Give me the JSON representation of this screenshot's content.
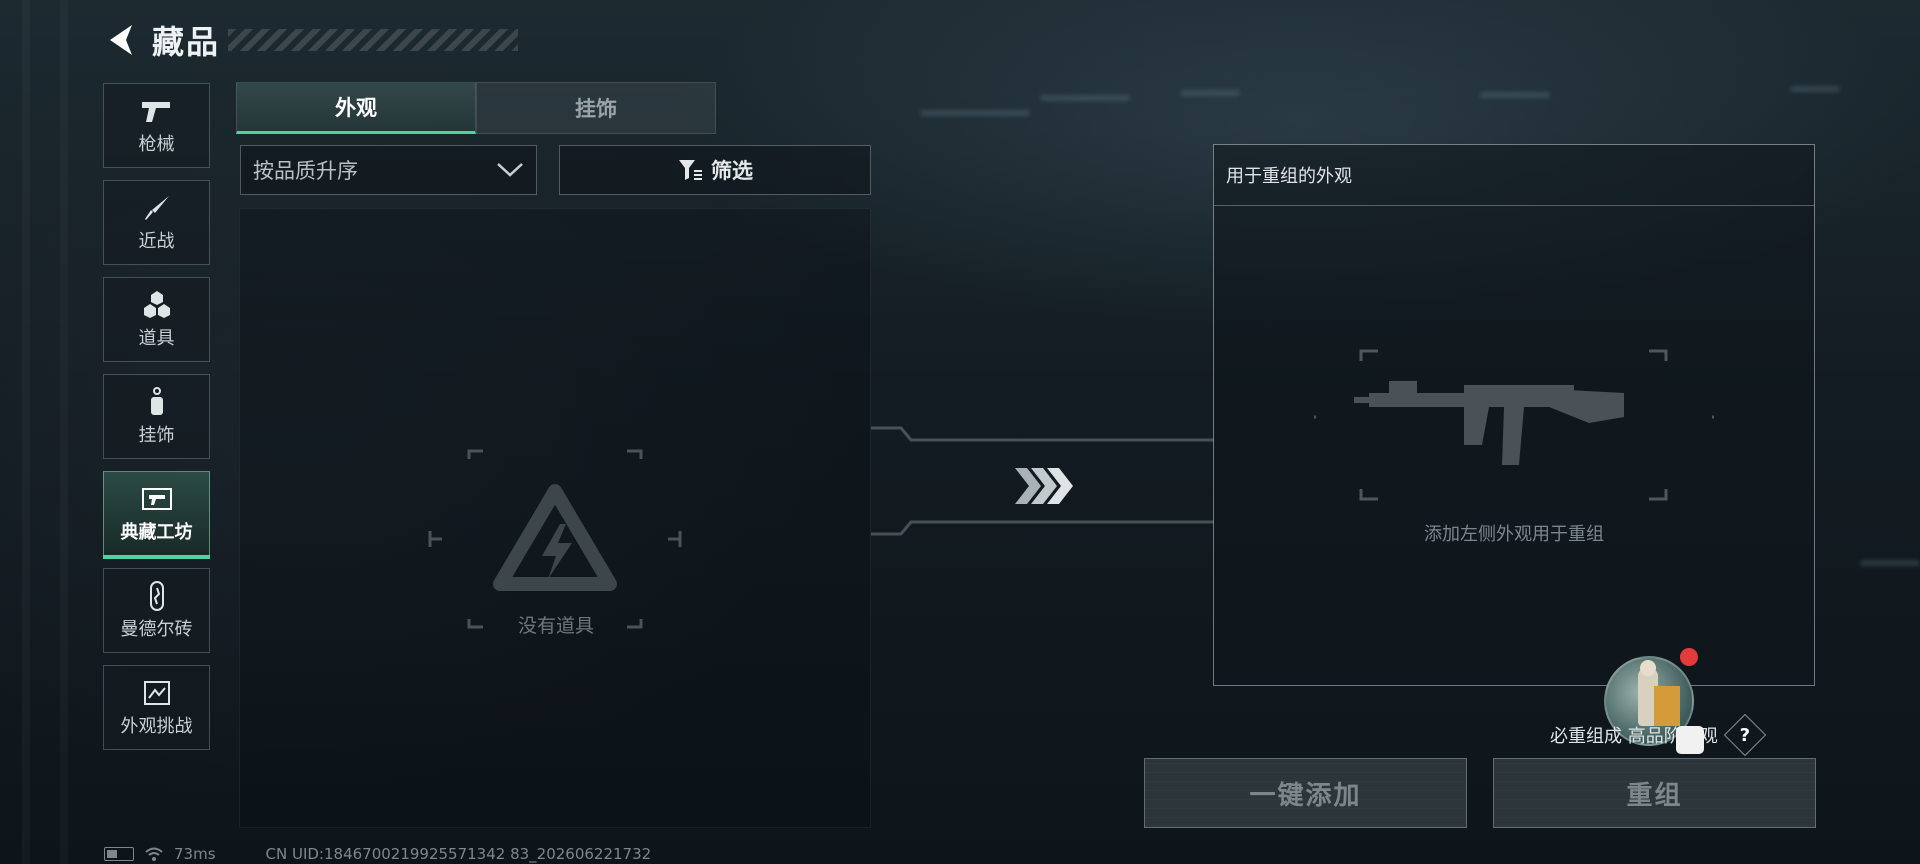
{
  "header": {
    "title": "藏品"
  },
  "sidebar": {
    "items": [
      {
        "label": "枪械",
        "icon": "pistol-icon",
        "active": false
      },
      {
        "label": "近战",
        "icon": "knife-icon",
        "active": false
      },
      {
        "label": "道具",
        "icon": "grenade-cluster-icon",
        "active": false
      },
      {
        "label": "挂饰",
        "icon": "charm-icon",
        "active": false
      },
      {
        "label": "典藏工坊",
        "icon": "workshop-icon",
        "active": true
      },
      {
        "label": "曼德尔砖",
        "icon": "brick-icon",
        "active": false
      },
      {
        "label": "外观挑战",
        "icon": "challenge-icon",
        "active": false
      }
    ]
  },
  "tabs": [
    {
      "label": "外观",
      "active": true
    },
    {
      "label": "挂饰",
      "active": false
    }
  ],
  "sort": {
    "value": "按品质升序"
  },
  "filter": {
    "label": "筛选"
  },
  "list": {
    "empty_text": "没有道具"
  },
  "recombine": {
    "title": "用于重组的外观",
    "hint": "添加左侧外观用于重组"
  },
  "chance": {
    "text": "必重组成  高品阶外观"
  },
  "buttons": {
    "add_all": "一键添加",
    "recombine": "重组"
  },
  "status": {
    "latency": "73ms",
    "uid": "CN UID:1846700219925571342 83_202606221732"
  },
  "colors": {
    "accent": "#4fd3a0",
    "notification": "#e33b3b"
  }
}
